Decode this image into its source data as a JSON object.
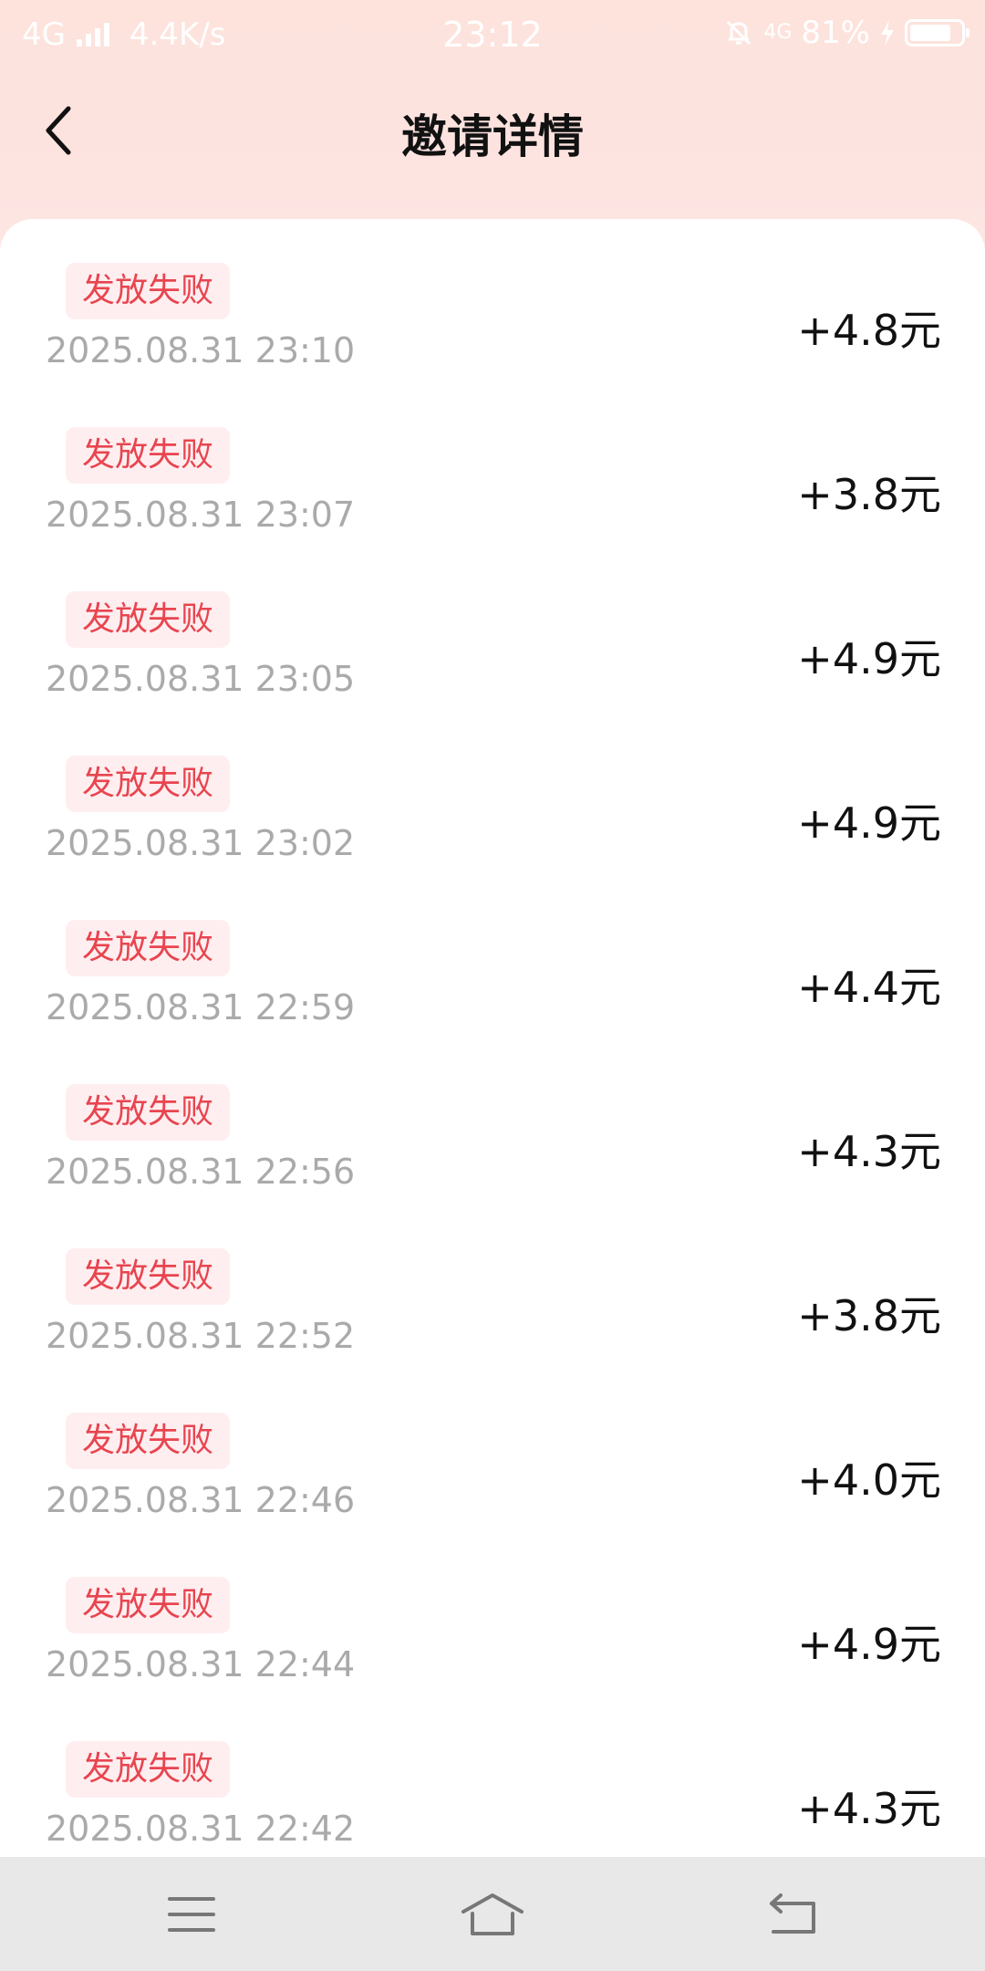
{
  "status_bar": {
    "network": "4G",
    "speed": "4.4K/s",
    "time": "23:12",
    "network_right": "4G",
    "battery": "81%",
    "battery_level": 0.81
  },
  "header": {
    "title": "邀请详情",
    "back_icon": "chevron-left-icon"
  },
  "records": [
    {
      "status": "发放失败",
      "time": "2025.08.31 23:10",
      "amount": "+4.8元"
    },
    {
      "status": "发放失败",
      "time": "2025.08.31 23:07",
      "amount": "+3.8元"
    },
    {
      "status": "发放失败",
      "time": "2025.08.31 23:05",
      "amount": "+4.9元"
    },
    {
      "status": "发放失败",
      "time": "2025.08.31 23:02",
      "amount": "+4.9元"
    },
    {
      "status": "发放失败",
      "time": "2025.08.31 22:59",
      "amount": "+4.4元"
    },
    {
      "status": "发放失败",
      "time": "2025.08.31 22:56",
      "amount": "+4.3元"
    },
    {
      "status": "发放失败",
      "time": "2025.08.31 22:52",
      "amount": "+3.8元"
    },
    {
      "status": "发放失败",
      "time": "2025.08.31 22:46",
      "amount": "+4.0元"
    },
    {
      "status": "发放失败",
      "time": "2025.08.31 22:44",
      "amount": "+4.9元"
    },
    {
      "status": "发放失败",
      "time": "2025.08.31 22:42",
      "amount": "+4.3元"
    }
  ],
  "colors": {
    "status_text": "#e8454f",
    "status_bg": "#ffeef0",
    "header_bg": "#fde3dc"
  },
  "system_nav": {
    "menu_icon": "menu-icon",
    "home_icon": "home-icon",
    "back_icon": "back-icon"
  }
}
